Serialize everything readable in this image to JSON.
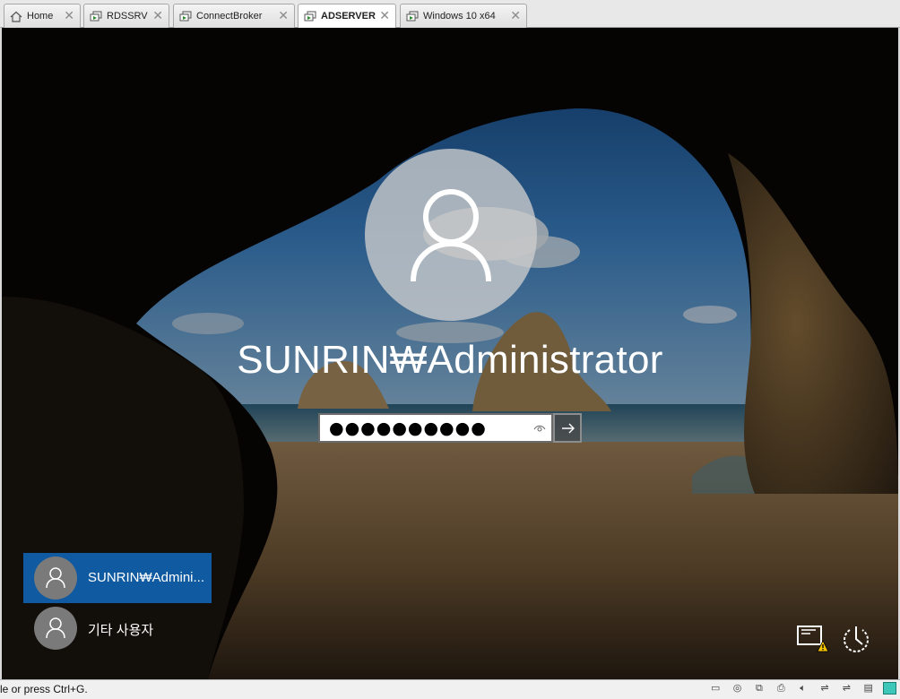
{
  "tabs": [
    {
      "label": "Home",
      "icon": "home-icon",
      "active": false
    },
    {
      "label": "RDSSRV",
      "icon": "vm-icon",
      "active": false
    },
    {
      "label": "ConnectBroker",
      "icon": "vm-icon",
      "active": false
    },
    {
      "label": "ADSERVER",
      "icon": "vm-icon",
      "active": true
    },
    {
      "label": "Windows 10 x64",
      "icon": "vm-icon",
      "active": false
    }
  ],
  "login": {
    "username": "SUNRIN₩Administrator",
    "password_mask": "●●●●●●●●●●",
    "submit_icon": "arrow-right-icon",
    "reveal_icon": "eye-icon"
  },
  "user_list": [
    {
      "label": "SUNRIN₩Admini...",
      "selected": true
    },
    {
      "label": "기타 사용자",
      "selected": false
    }
  ],
  "corner_icons": [
    "network-warning-icon",
    "ease-of-access-power-icon"
  ],
  "statusbar": {
    "text": "le or press Ctrl+G.",
    "icons": [
      "hdd-icon",
      "cd-icon",
      "network-icon",
      "printer-icon",
      "sound-icon",
      "usb-icon",
      "usb-icon",
      "display-icon",
      "message-icon"
    ]
  },
  "colors": {
    "selected_tile": "#0f5aa0",
    "tab_active": "#ffffff"
  }
}
